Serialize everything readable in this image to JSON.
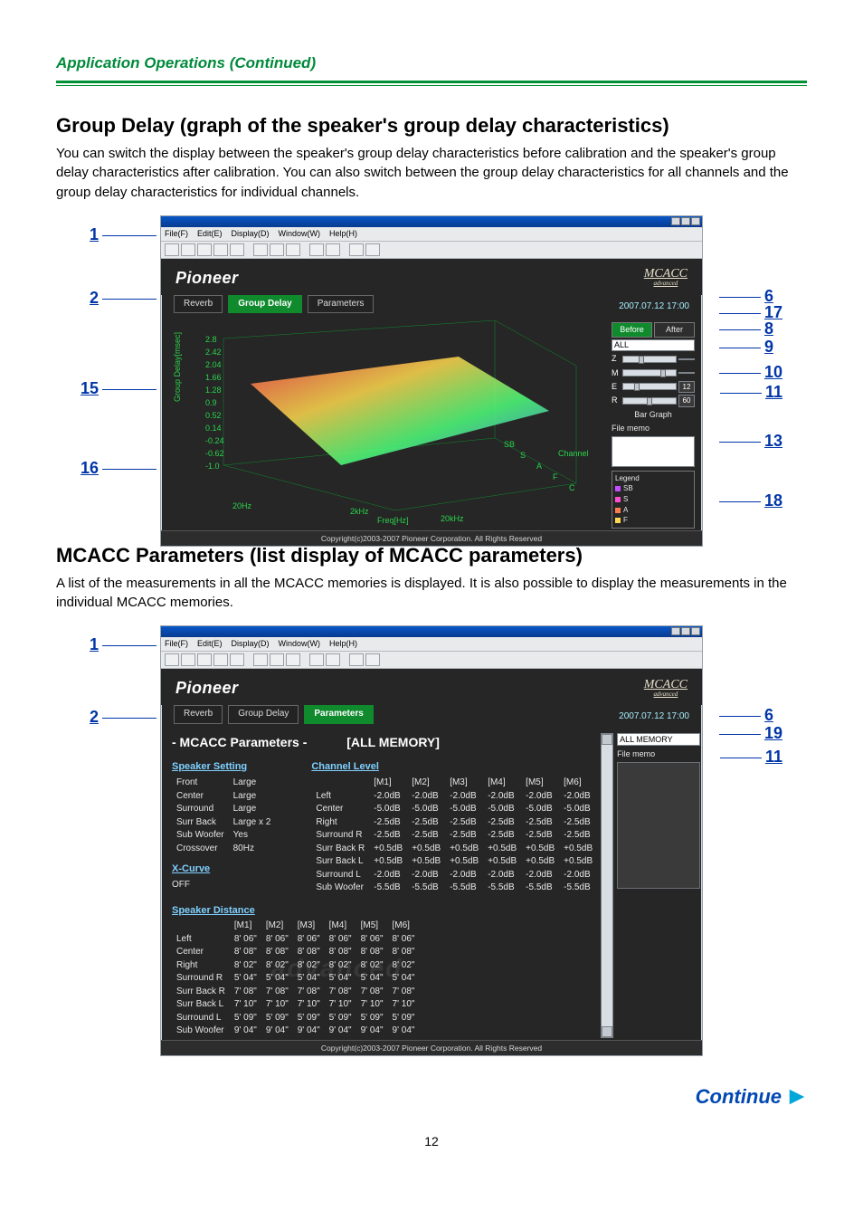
{
  "runningHead": "Application Operations (Continued)",
  "section1": {
    "heading": "Group Delay (graph of the speaker's group delay characteristics)",
    "lead": "You can switch the display between the speaker's group delay characteristics before calibration and the speaker's group delay characteristics after calibration. You can also switch between the group delay characteristics for all channels and the group delay characteristics for individual channels.",
    "menubar": [
      "File(F)",
      "Edit(E)",
      "Display(D)",
      "Window(W)",
      "Help(H)"
    ],
    "tabs": {
      "reverb": "Reverb",
      "groupDelay": "Group Delay",
      "parameters": "Parameters"
    },
    "timestamp": "2007.07.12 17:00",
    "beforeAfter": {
      "before": "Before",
      "after": "After"
    },
    "channelSelect": "ALL",
    "sliders": {
      "Z": "",
      "M": "",
      "E": "12",
      "R": "60"
    },
    "sideCaptions": {
      "barGraph": "Bar Graph",
      "fileMemo": "File memo"
    },
    "legend": {
      "title": "Legend",
      "items": [
        "SB",
        "S",
        "A",
        "F"
      ]
    },
    "axis": {
      "y": "Group Delay[msec]",
      "x": "Freq[Hz]",
      "chan": "Channel",
      "xticks": [
        "20Hz",
        "2kHz",
        "20kHz"
      ],
      "yticks": [
        "2.8",
        "2.42",
        "2.04",
        "1.66",
        "1.28",
        "0.9",
        "0.52",
        "0.14",
        "-0.24",
        "-0.62",
        "-1.0"
      ],
      "chTicks": [
        "SB",
        "S",
        "A",
        "F",
        "C"
      ]
    },
    "status": "Copyright(c)2003-2007 Pioneer Corporation. All Rights Reserved",
    "callouts": {
      "left": [
        "1",
        "2",
        "15",
        "16"
      ],
      "right": [
        "6",
        "17",
        "8",
        "9",
        "10",
        "11",
        "13",
        "18"
      ]
    }
  },
  "section2": {
    "heading": "MCACC Parameters (list display of MCACC parameters)",
    "lead": "A list of the measurements in all the MCACC memories is displayed. It is also possible to display the measurements in the individual MCACC memories.",
    "menubar": [
      "File(F)",
      "Edit(E)",
      "Display(D)",
      "Window(W)",
      "Help(H)"
    ],
    "tabs": {
      "reverb": "Reverb",
      "groupDelay": "Group Delay",
      "parameters": "Parameters"
    },
    "timestamp": "2007.07.12 17:00",
    "memSelect": "ALL MEMORY",
    "fileMemoLabel": "File memo",
    "title": "- MCACC Parameters -",
    "titleScope": "[ALL MEMORY]",
    "speakerSetting": {
      "title": "Speaker Setting",
      "rows": [
        [
          "Front",
          "Large"
        ],
        [
          "Center",
          "Large"
        ],
        [
          "Surround",
          "Large"
        ],
        [
          "Surr Back",
          "Large x 2"
        ],
        [
          "Sub Woofer",
          "Yes"
        ],
        [
          "Crossover",
          "80Hz"
        ]
      ]
    },
    "xcurve": {
      "title": "X-Curve",
      "value": "OFF"
    },
    "channelLevel": {
      "title": "Channel Level",
      "cols": [
        "[M1]",
        "[M2]",
        "[M3]",
        "[M4]",
        "[M5]",
        "[M6]"
      ],
      "rows": [
        [
          "Left",
          "-2.0dB",
          "-2.0dB",
          "-2.0dB",
          "-2.0dB",
          "-2.0dB",
          "-2.0dB"
        ],
        [
          "Center",
          "-5.0dB",
          "-5.0dB",
          "-5.0dB",
          "-5.0dB",
          "-5.0dB",
          "-5.0dB"
        ],
        [
          "Right",
          "-2.5dB",
          "-2.5dB",
          "-2.5dB",
          "-2.5dB",
          "-2.5dB",
          "-2.5dB"
        ],
        [
          "Surround R",
          "-2.5dB",
          "-2.5dB",
          "-2.5dB",
          "-2.5dB",
          "-2.5dB",
          "-2.5dB"
        ],
        [
          "Surr Back R",
          "+0.5dB",
          "+0.5dB",
          "+0.5dB",
          "+0.5dB",
          "+0.5dB",
          "+0.5dB"
        ],
        [
          "Surr Back L",
          "+0.5dB",
          "+0.5dB",
          "+0.5dB",
          "+0.5dB",
          "+0.5dB",
          "+0.5dB"
        ],
        [
          "Surround L",
          "-2.0dB",
          "-2.0dB",
          "-2.0dB",
          "-2.0dB",
          "-2.0dB",
          "-2.0dB"
        ],
        [
          "Sub Woofer",
          "-5.5dB",
          "-5.5dB",
          "-5.5dB",
          "-5.5dB",
          "-5.5dB",
          "-5.5dB"
        ]
      ]
    },
    "speakerDistance": {
      "title": "Speaker Distance",
      "cols": [
        "[M1]",
        "[M2]",
        "[M3]",
        "[M4]",
        "[M5]",
        "[M6]"
      ],
      "rows": [
        [
          "Left",
          "8' 06\"",
          "8' 06\"",
          "8' 06\"",
          "8' 06\"",
          "8' 06\"",
          "8' 06\""
        ],
        [
          "Center",
          "8' 08\"",
          "8' 08\"",
          "8' 08\"",
          "8' 08\"",
          "8' 08\"",
          "8' 08\""
        ],
        [
          "Right",
          "8' 02\"",
          "8' 02\"",
          "8' 02\"",
          "8' 02\"",
          "8' 02\"",
          "8' 02\""
        ],
        [
          "Surround R",
          "5' 04\"",
          "5' 04\"",
          "5' 04\"",
          "5' 04\"",
          "5' 04\"",
          "5' 04\""
        ],
        [
          "Surr Back R",
          "7' 08\"",
          "7' 08\"",
          "7' 08\"",
          "7' 08\"",
          "7' 08\"",
          "7' 08\""
        ],
        [
          "Surr Back L",
          "7' 10\"",
          "7' 10\"",
          "7' 10\"",
          "7' 10\"",
          "7' 10\"",
          "7' 10\""
        ],
        [
          "Surround L",
          "5' 09\"",
          "5' 09\"",
          "5' 09\"",
          "5' 09\"",
          "5' 09\"",
          "5' 09\""
        ],
        [
          "Sub Woofer",
          "9' 04\"",
          "9' 04\"",
          "9' 04\"",
          "9' 04\"",
          "9' 04\"",
          "9' 04\""
        ]
      ]
    },
    "status": "Copyright(c)2003-2007 Pioneer Corporation. All Rights Reserved",
    "callouts": {
      "left": [
        "1",
        "2"
      ],
      "right": [
        "6",
        "19",
        "11"
      ]
    }
  },
  "continue": "Continue",
  "pageNumber": "12",
  "brand": {
    "pioneer": "Pioneer",
    "badge": "MCACC",
    "badgeSub": "advanced"
  },
  "watermark": "advanced"
}
